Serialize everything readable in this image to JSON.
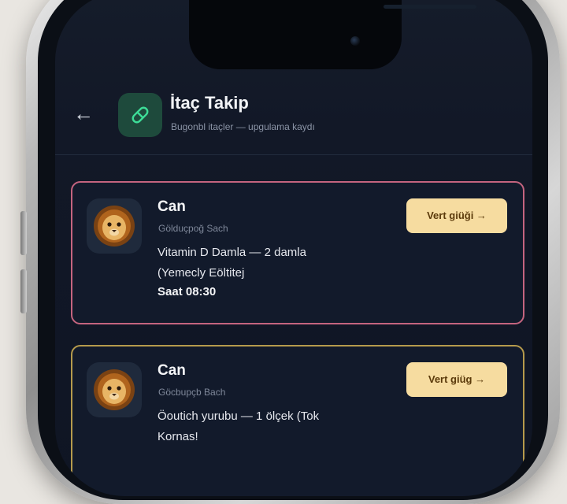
{
  "header": {
    "back_icon": "arrow-left-icon",
    "app_icon": "pill-icon",
    "title": "İtaç Takip",
    "subtitle": "Bugonbl itaçler — upgulama kaydı"
  },
  "cards": [
    {
      "pet_name": "Can",
      "breed": "Gölduçpoğ Sach",
      "medication_line1": "Vitamin D Damla — 2 damla",
      "medication_line2": "(Yemecly Eöltitej",
      "time": "Saat 08:30",
      "button_label": "Vert giüği →",
      "border_color": "#c4647f"
    },
    {
      "pet_name": "Can",
      "breed": "Göcbupçb Bach",
      "medication_line1": "Öoutich yurubu — 1 ölçek (Tok",
      "medication_line2": "Kornas!",
      "time": "",
      "button_label": "Vert giüg →",
      "border_color": "#b59a4c"
    }
  ],
  "colors": {
    "screen_bg": "#121827",
    "card_bg": "#121a2b",
    "button_bg": "#f6dca0",
    "accent_green": "#1e4a3c"
  }
}
